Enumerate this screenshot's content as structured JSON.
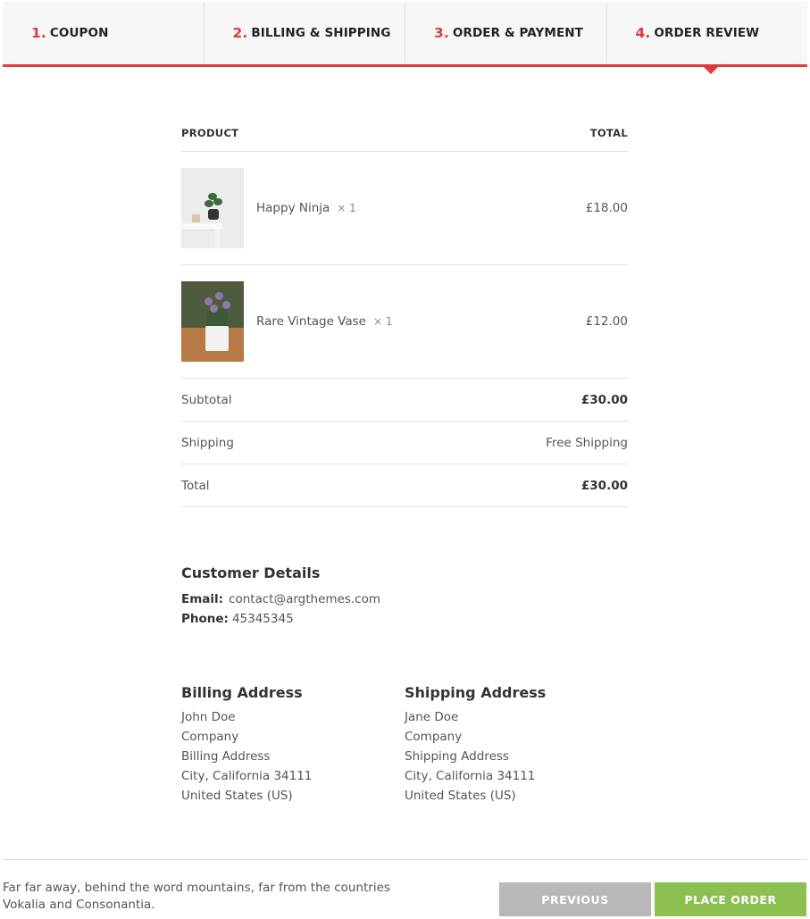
{
  "steps": [
    {
      "num": "1.",
      "label": "COUPON"
    },
    {
      "num": "2.",
      "label": "BILLING & SHIPPING"
    },
    {
      "num": "3.",
      "label": "ORDER & PAYMENT"
    },
    {
      "num": "4.",
      "label": "ORDER REVIEW"
    }
  ],
  "order": {
    "col_product": "PRODUCT",
    "col_total": "TOTAL",
    "items": [
      {
        "name": "Happy Ninja",
        "qty": "× 1",
        "price": "£18.00"
      },
      {
        "name": "Rare Vintage Vase",
        "qty": "× 1",
        "price": "£12.00"
      }
    ],
    "totals": [
      {
        "label": "Subtotal",
        "value": "£30.00"
      },
      {
        "label": "Shipping",
        "value": "Free Shipping"
      },
      {
        "label": "Total",
        "value": "£30.00"
      }
    ]
  },
  "customer": {
    "heading": "Customer Details",
    "email_label": "Email:",
    "email": "contact@argthemes.com",
    "phone_label": "Phone:",
    "phone": "45345345"
  },
  "billing": {
    "heading": "Billing Address",
    "lines": [
      "John Doe",
      "Company",
      "Billing Address",
      "City, California 34111",
      "United States (US)"
    ]
  },
  "shipping": {
    "heading": "Shipping Address",
    "lines": [
      "Jane Doe",
      "Company",
      "Shipping Address",
      "City, California 34111",
      "United States (US)"
    ]
  },
  "footer": {
    "text": "Far far away, behind the word mountains, far from the countries Vokalia and Consonantia.",
    "previous_label": "PREVIOUS",
    "place_order_label": "PLACE ORDER"
  },
  "colors": {
    "accent": "#e13a3a",
    "place_order": "#8cc152",
    "previous": "#b8b8b8"
  }
}
